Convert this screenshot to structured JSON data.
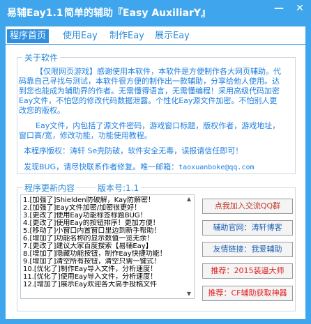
{
  "window": {
    "app_name": "易辅Eay1.1",
    "subtitle": "简单的辅助『Easy AuxiliarY』",
    "minimize_glyph": "—",
    "close_glyph": "✕"
  },
  "tabs": [
    {
      "label": "程序首页",
      "active": true
    },
    {
      "label": "使用Eay",
      "active": false
    },
    {
      "label": "制作Eay",
      "active": false
    },
    {
      "label": "展示Eay",
      "active": false
    }
  ],
  "about": {
    "title": "关于软件",
    "paragraph1": "【仅限网页游戏】感谢使用本软件，本软件是方便制作各大网页辅助。代码靠自己寻找与测试，本软件很方便的制作出一款辅助，分享给他人使用。达到您也能成为辅助界的作者。无需懂得语言，无需懂编程！采用高级代码加密Eay文件，不怕您的修改代码数据泄露。个性化Eay源文件加密。不怕别人更改您的版权。",
    "paragraph2": "Eay文件，内包括了源文件密码，游戏窗口标题，版权作者，游戏地址，窗口高/宽，修改功能，功能使用教程。",
    "copyright_line": "本程序版权：涛轩      Se壳防破，软件安全无毒，误报请信任即可！",
    "contact_prefix": "发现BUG，请尽快联系作者修复。唯一邮箱：",
    "contact_email": "taoxuanboke@qq.com"
  },
  "changelog": {
    "title": "程序更新内容",
    "version_label": "版本号:1.1",
    "items": [
      "1.[加强了]Shielden防破解，Kay防解密！",
      "2.[加强了]Eay文件加密/加密很更好！",
      "3.[更改了]使用Eay功能标签标题BUG！",
      "4.[更改了]使用Eay的按钮排序！更加方便！",
      "5.[移动了]小窗口内置窗口里边到新手帮助！",
      "6.[增加了]功能名称的显示数值一览无余！",
      "7.[更改了]建议大家百度搜索【易辅Eay】",
      "8.[增加了]隐藏功能按钮，制作Eay快捷功能！",
      "9.[增加了]清空所有按钮，清空只需一键式！",
      "10.[优化了]制作Eay导入文件，分析速度！",
      "11.[优化了]使用Eay导入文件，分析速度！",
      "12.[增加了]展示Eay欢迎各大高手投稿文件"
    ],
    "scroll_up_glyph": "▲",
    "scroll_down_glyph": "▼"
  },
  "side_buttons": [
    {
      "label": "点我加入交流QQ群",
      "color": "#c0392b"
    },
    {
      "label": "辅助官网：涛轩博客",
      "color": "#1a5fb4"
    },
    {
      "label": "友情链接：我爱辅助",
      "color": "#1a5fb4"
    },
    {
      "label": "推荐：2015装逼大师",
      "color": "#e02020"
    },
    {
      "label": "推荐：CF辅助获取神器",
      "color": "#e02020"
    }
  ]
}
